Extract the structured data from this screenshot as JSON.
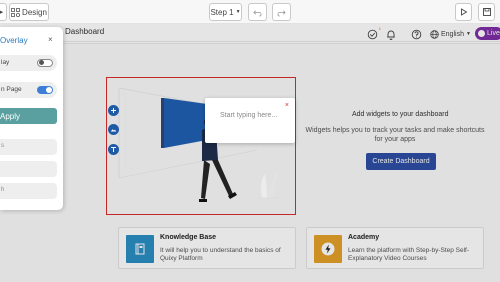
{
  "toolbar": {
    "design_label": "Design",
    "step_label": "Step 1"
  },
  "header": {
    "language": "English",
    "live_label": "Live",
    "notification_badge": "1"
  },
  "breadcrumb": {
    "title": "Dashboard"
  },
  "overlay_panel": {
    "title": "Overlay",
    "close": "×",
    "toggle1_label": "lay",
    "toggle1_on": false,
    "toggle2_label": "n Page",
    "toggle2_on": true,
    "apply_label": "Apply",
    "item1_label": "s",
    "item3_label": "h"
  },
  "popup": {
    "placeholder": "Start typing here...",
    "close": "×"
  },
  "empty_state": {
    "title": "Add widgets to your dashboard",
    "description": "Widgets helps you to track your tasks and make shortcuts for your apps",
    "button_label": "Create Dashboard"
  },
  "cards": [
    {
      "title": "Knowledge Base",
      "description": "It will help you to understand the basics of Quixy Platform",
      "icon": "book-icon",
      "color": "#2a8fc4"
    },
    {
      "title": "Academy",
      "description": "Learn the platform with Step-by-Step Self-Explanatory Video Courses",
      "icon": "lightning-icon",
      "color": "#e4a12a"
    }
  ],
  "colors": {
    "accent_blue": "#2e4ea5",
    "highlight_red": "#c62828",
    "live_purple": "#7d2ea6",
    "panel_title": "#2b7bbd",
    "apply_teal": "#5aa0a0"
  }
}
